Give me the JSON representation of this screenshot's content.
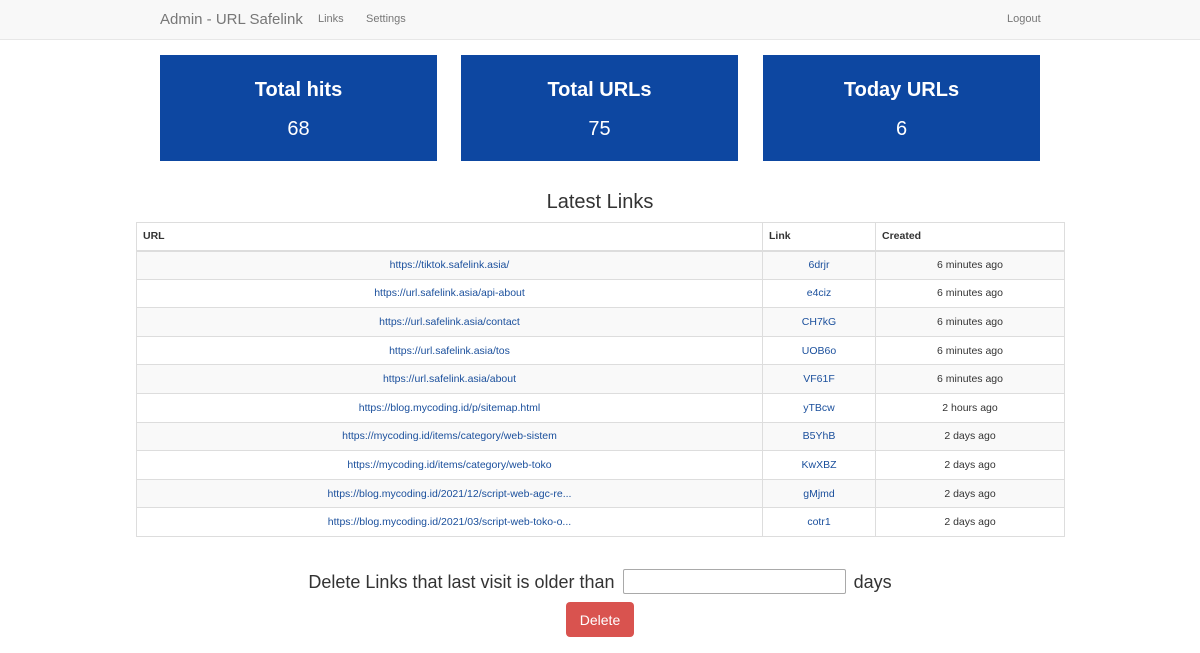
{
  "navbar": {
    "brand": "Admin - URL Safelink",
    "links_label": "Links",
    "settings_label": "Settings",
    "logout_label": "Logout"
  },
  "stats": {
    "total_hits": {
      "title": "Total hits",
      "value": "68"
    },
    "total_urls": {
      "title": "Total URLs",
      "value": "75"
    },
    "today_urls": {
      "title": "Today URLs",
      "value": "6"
    }
  },
  "latest_links": {
    "title": "Latest Links",
    "headers": {
      "url": "URL",
      "link": "Link",
      "created": "Created"
    },
    "rows": [
      {
        "url": "https://tiktok.safelink.asia/",
        "link": "6drjr",
        "created": "6 minutes ago"
      },
      {
        "url": "https://url.safelink.asia/api-about",
        "link": "e4ciz",
        "created": "6 minutes ago"
      },
      {
        "url": "https://url.safelink.asia/contact",
        "link": "CH7kG",
        "created": "6 minutes ago"
      },
      {
        "url": "https://url.safelink.asia/tos",
        "link": "UOB6o",
        "created": "6 minutes ago"
      },
      {
        "url": "https://url.safelink.asia/about",
        "link": "VF61F",
        "created": "6 minutes ago"
      },
      {
        "url": "https://blog.mycoding.id/p/sitemap.html",
        "link": "yTBcw",
        "created": "2 hours ago"
      },
      {
        "url": "https://mycoding.id/items/category/web-sistem",
        "link": "B5YhB",
        "created": "2 days ago"
      },
      {
        "url": "https://mycoding.id/items/category/web-toko",
        "link": "KwXBZ",
        "created": "2 days ago"
      },
      {
        "url": "https://blog.mycoding.id/2021/12/script-web-agc-re...",
        "link": "gMjmd",
        "created": "2 days ago"
      },
      {
        "url": "https://blog.mycoding.id/2021/03/script-web-toko-o...",
        "link": "cotr1",
        "created": "2 days ago"
      }
    ]
  },
  "delete_form": {
    "prefix": "Delete Links that last visit is older than",
    "days_value": "",
    "suffix": "days",
    "button_label": "Delete"
  },
  "colors": {
    "card_background": "#0d47a1",
    "link_color": "#1a4f9c",
    "delete_button": "#d9534f"
  }
}
